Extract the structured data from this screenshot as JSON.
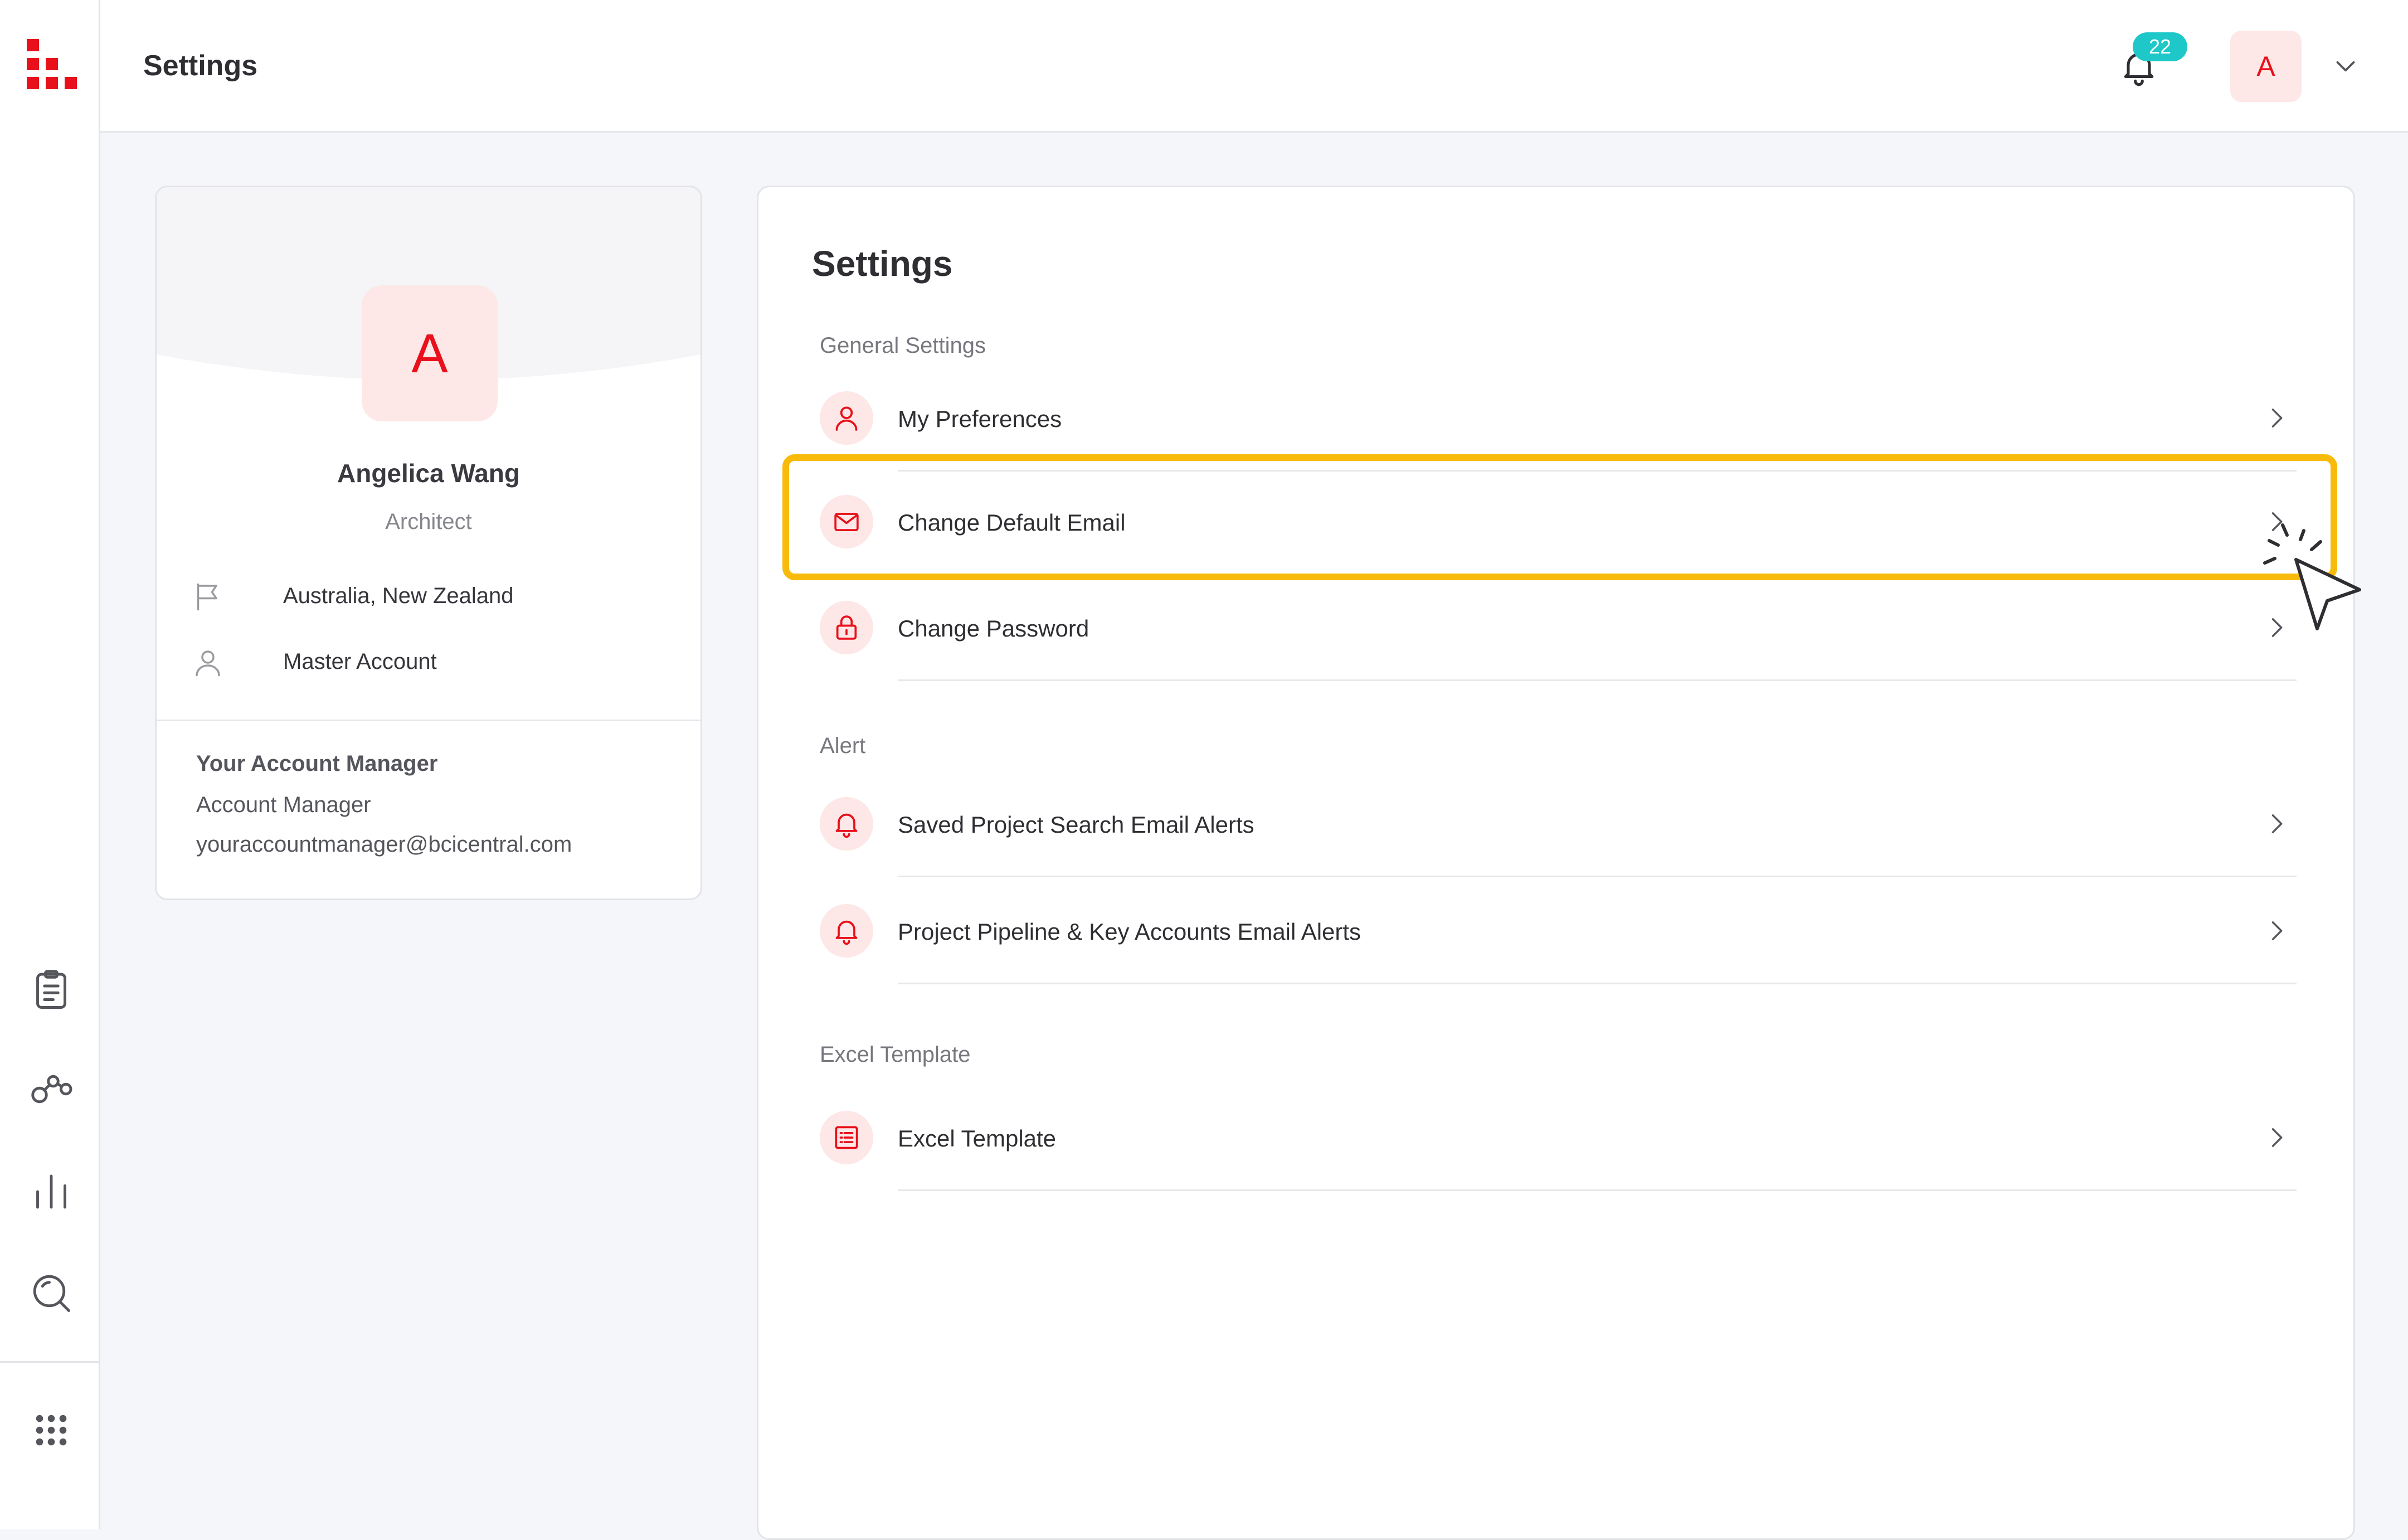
{
  "header": {
    "title": "Settings",
    "notification_count": "22",
    "avatar_initial": "A"
  },
  "sidebar": {
    "icons": [
      "app-logo-icon",
      "clipboard-icon",
      "network-icon",
      "bar-chart-icon",
      "search-icon",
      "grid-dots-icon"
    ]
  },
  "profile": {
    "initial": "A",
    "name": "Angelica Wang",
    "role": "Architect",
    "region": "Australia, New Zealand",
    "account_type": "Master Account",
    "manager_heading": "Your Account Manager",
    "manager_name": "Account Manager",
    "manager_email": "youraccountmanager@bcicentral.com"
  },
  "settings": {
    "title": "Settings",
    "sections": [
      {
        "label": "General Settings",
        "items": [
          {
            "label": "My Preferences",
            "icon": "user-icon"
          },
          {
            "label": "Change Default Email",
            "icon": "mail-icon"
          },
          {
            "label": "Change Password",
            "icon": "lock-icon"
          }
        ]
      },
      {
        "label": "Alert",
        "items": [
          {
            "label": "Saved Project Search Email Alerts",
            "icon": "bell-icon"
          },
          {
            "label": "Project Pipeline & Key Accounts Email Alerts",
            "icon": "bell-icon"
          }
        ]
      },
      {
        "label": "Excel Template",
        "items": [
          {
            "label": "Excel Template",
            "icon": "list-icon"
          }
        ]
      }
    ]
  },
  "colors": {
    "brand_red": "#e8101a",
    "soft_red": "#fde7e7",
    "badge_teal": "#1ec8c8",
    "highlight_yellow": "#f8bb0c"
  }
}
